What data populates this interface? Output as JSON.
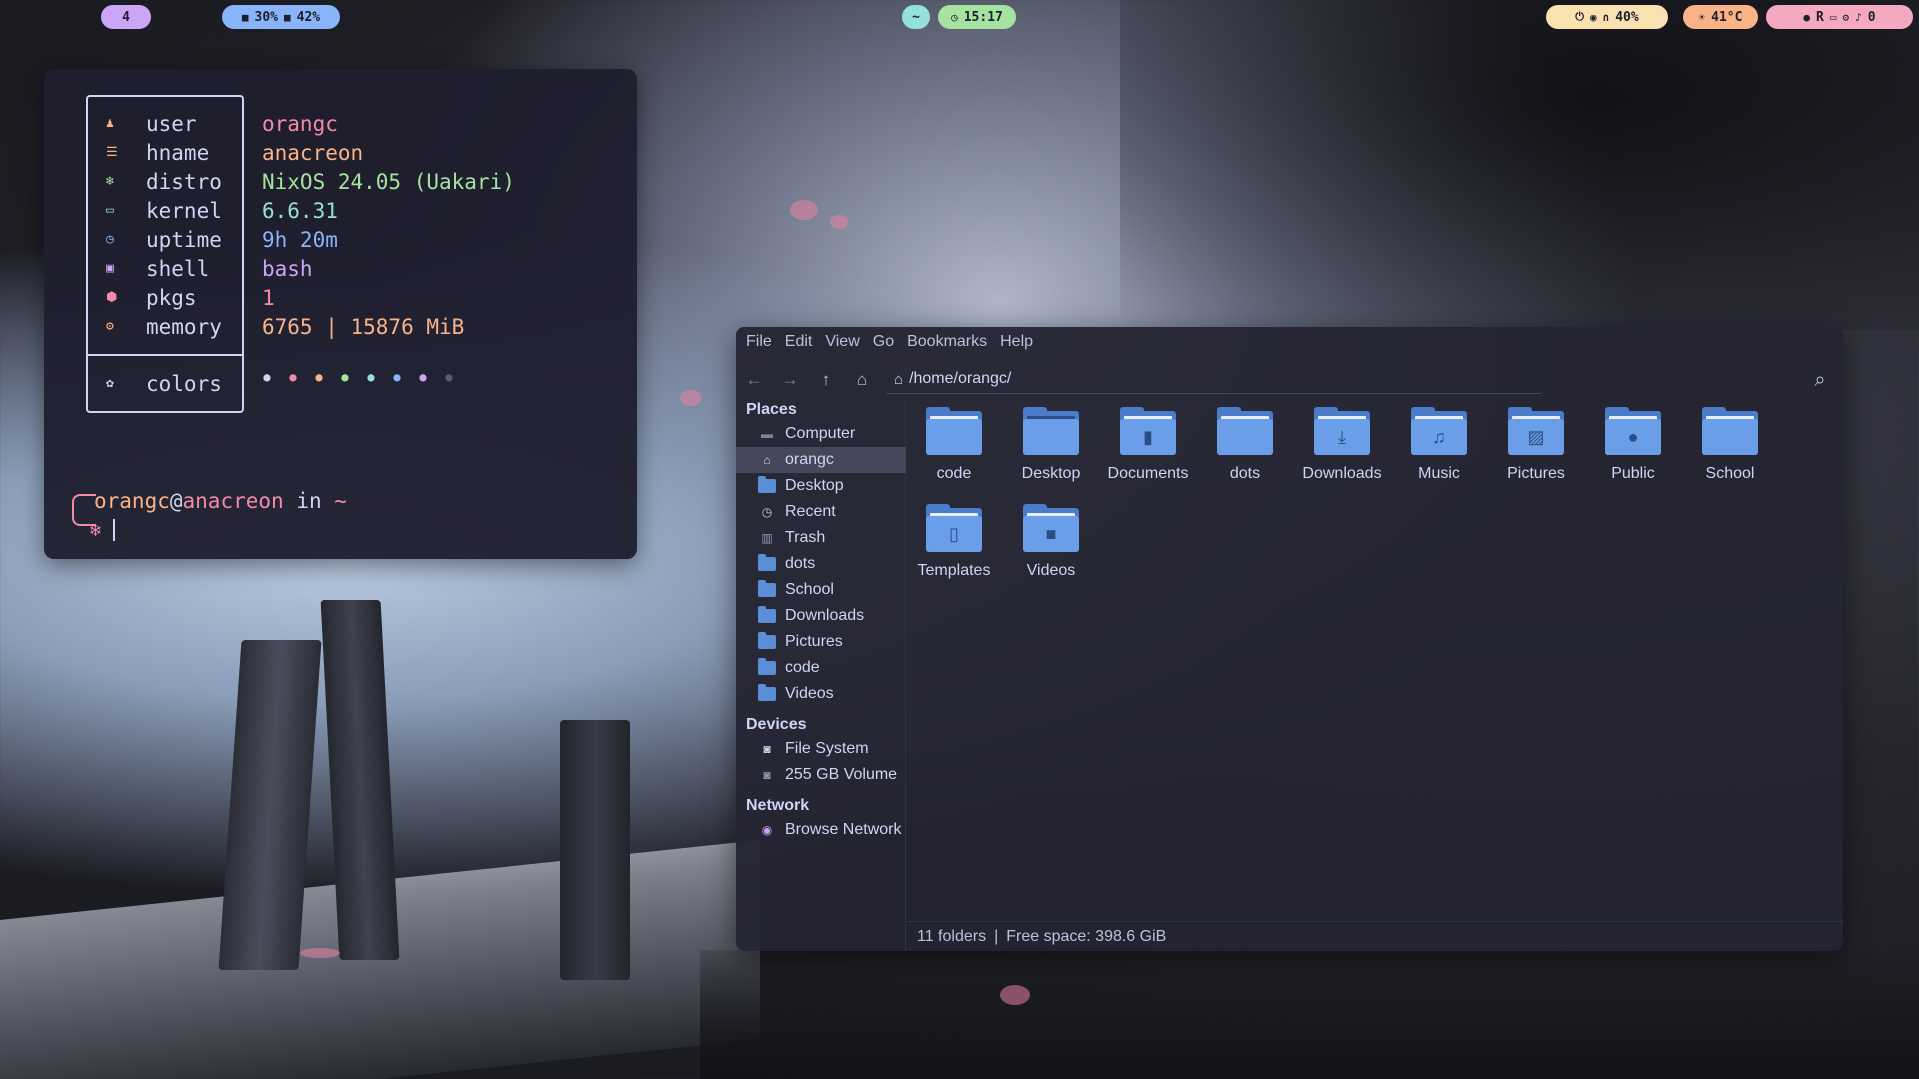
{
  "topbar": {
    "workspace": "4",
    "cpu": "30%",
    "ram": "42%",
    "time": "15:17",
    "volume": "40%",
    "temperature": "41°C",
    "right_label": "R",
    "notifications": "0",
    "colors": {
      "workspace_bg": "#cba6f7",
      "cpu_bg": "#89b4fa",
      "clock_bg": "#a6e3a1",
      "media_bg": "#94e2d5",
      "audio_bg": "#f9e2af",
      "temp_bg": "#fab387",
      "tray_bg": "#f5a9c0"
    }
  },
  "terminal": {
    "fetch": [
      {
        "icon": "user-icon",
        "glyph": "♟",
        "key": "user",
        "value": "orangc",
        "icon_color": "#fab387",
        "value_color": "#f38ba8"
      },
      {
        "icon": "hostname-icon",
        "glyph": "☰",
        "key": "hname",
        "value": "anacreon",
        "icon_color": "#fab387",
        "value_color": "#fab387"
      },
      {
        "icon": "distro-icon",
        "glyph": "❄",
        "key": "distro",
        "value": "NixOS 24.05 (Uakari)",
        "icon_color": "#a6e3a1",
        "value_color": "#a6e3a1"
      },
      {
        "icon": "kernel-icon",
        "glyph": "▭",
        "key": "kernel",
        "value": "6.6.31",
        "icon_color": "#94e2d5",
        "value_color": "#94e2d5"
      },
      {
        "icon": "uptime-icon",
        "glyph": "◷",
        "key": "uptime",
        "value": "9h 20m",
        "icon_color": "#89b4fa",
        "value_color": "#89b4fa"
      },
      {
        "icon": "shell-icon",
        "glyph": "▣",
        "key": "shell",
        "value": "bash",
        "icon_color": "#cba6f7",
        "value_color": "#cba6f7"
      },
      {
        "icon": "packages-icon",
        "glyph": "⬢",
        "key": "pkgs",
        "value": "1",
        "icon_color": "#f38ba8",
        "value_color": "#f38ba8"
      },
      {
        "icon": "memory-icon",
        "glyph": "⚙",
        "key": "memory",
        "value": "6765 | 15876 MiB",
        "icon_color": "#fab387",
        "value_color": "#fab387"
      }
    ],
    "colors_row": {
      "key": "colors",
      "glyph": "●",
      "palette": [
        "#cdd6f4",
        "#f38ba8",
        "#fab387",
        "#a6e3a1",
        "#94e2d5",
        "#89b4fa",
        "#cba6f7",
        "#585b70"
      ]
    },
    "prompt": {
      "user": "orangc",
      "at": "@",
      "host": "anacreon",
      "in": " in ",
      "dir": "~",
      "snowflake": "❄"
    }
  },
  "file_manager": {
    "menu": [
      "File",
      "Edit",
      "View",
      "Go",
      "Bookmarks",
      "Help"
    ],
    "path": "/home/orangc/",
    "sidebar": {
      "places_label": "Places",
      "places": [
        "Computer",
        "orangc",
        "Desktop",
        "Recent",
        "Trash",
        "dots",
        "School",
        "Downloads",
        "Pictures",
        "code",
        "Videos"
      ],
      "devices_label": "Devices",
      "devices": [
        "File System",
        "255 GB Volume"
      ],
      "network_label": "Network",
      "network": [
        "Browse Network"
      ]
    },
    "items": [
      {
        "label": "code",
        "icon": "folder-icon",
        "emblem": ""
      },
      {
        "label": "Desktop",
        "icon": "desktop-folder-icon",
        "emblem": ""
      },
      {
        "label": "Documents",
        "icon": "documents-folder-icon",
        "emblem": "▮"
      },
      {
        "label": "dots",
        "icon": "folder-icon",
        "emblem": ""
      },
      {
        "label": "Downloads",
        "icon": "downloads-folder-icon",
        "emblem": "⤓"
      },
      {
        "label": "Music",
        "icon": "music-folder-icon",
        "emblem": "♫"
      },
      {
        "label": "Pictures",
        "icon": "pictures-folder-icon",
        "emblem": "▨"
      },
      {
        "label": "Public",
        "icon": "public-folder-icon",
        "emblem": "●"
      },
      {
        "label": "School",
        "icon": "folder-icon",
        "emblem": ""
      },
      {
        "label": "Templates",
        "icon": "templates-folder-icon",
        "emblem": "▯"
      },
      {
        "label": "Videos",
        "icon": "videos-folder-icon",
        "emblem": "■"
      }
    ],
    "status": {
      "folders": "11 folders",
      "sep": "|",
      "free_space": "Free space: 398.6 GiB"
    },
    "accent": "#6b9ee8"
  }
}
